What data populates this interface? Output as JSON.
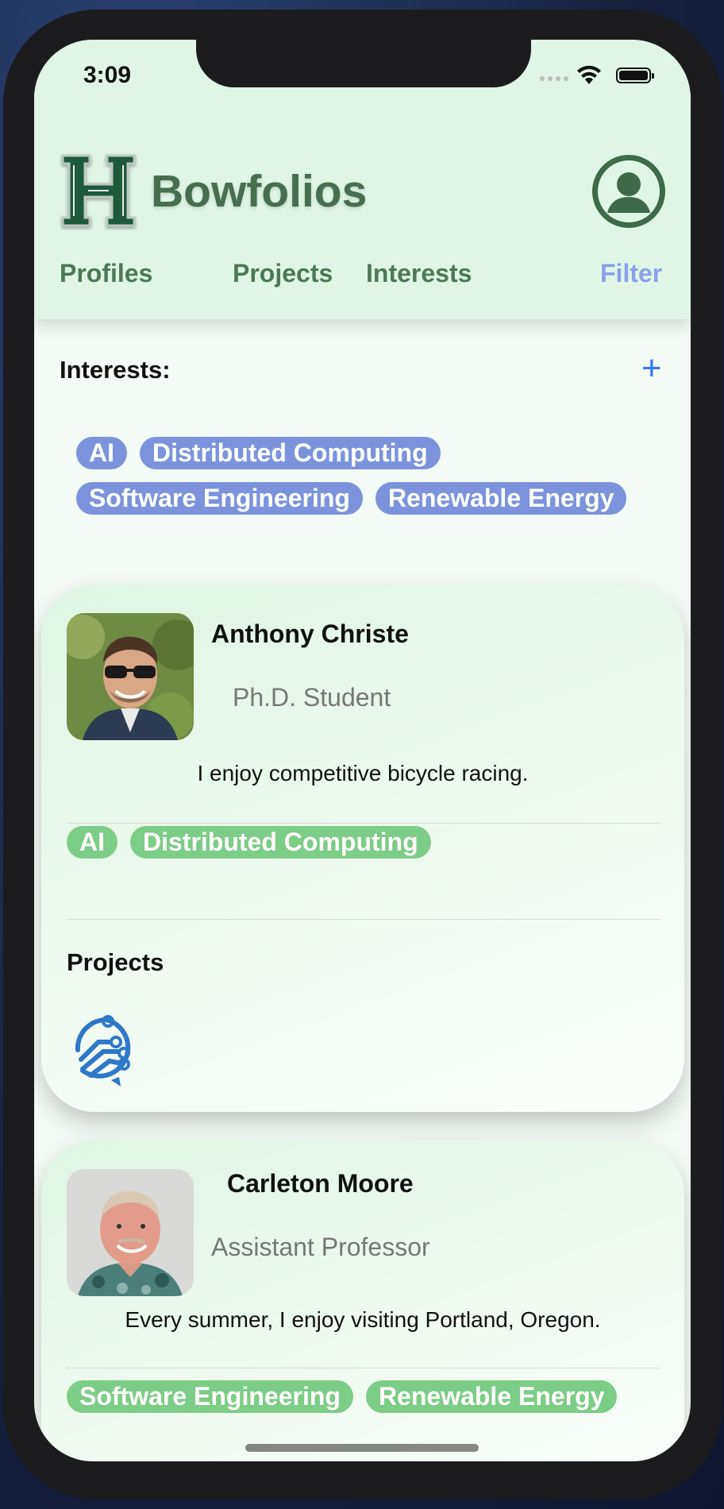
{
  "status_bar": {
    "time": "3:09"
  },
  "app": {
    "title": "Bowfolios"
  },
  "nav": [
    {
      "label": "Profiles",
      "active": false
    },
    {
      "label": "Projects",
      "active": false
    },
    {
      "label": "Interests",
      "active": false
    },
    {
      "label": "Filter",
      "active": true
    }
  ],
  "filter": {
    "label": "Interests:",
    "add_label": "+",
    "chips": [
      "AI",
      "Distributed Computing",
      "Software Engineering",
      "Renewable Energy"
    ]
  },
  "profiles": [
    {
      "name": "Anthony Christe",
      "title": "Ph.D. Student",
      "bio": "I enjoy competitive bicycle racing.",
      "interests": [
        "AI",
        "Distributed Computing"
      ],
      "projects_label": "Projects"
    },
    {
      "name": "Carleton Moore",
      "title": "Assistant Professor",
      "bio": "Every summer, I enjoy visiting Portland, Oregon.",
      "interests": [
        "Software Engineering",
        "Renewable Energy"
      ]
    }
  ],
  "colors": {
    "accent": "#2f7bf2",
    "header_bg": "#e0f5e6",
    "brand_green": "#466e4f",
    "chip_blue": "#7c93dc",
    "chip_green": "#7ccd86",
    "active_tab": "#8ba0ea"
  }
}
